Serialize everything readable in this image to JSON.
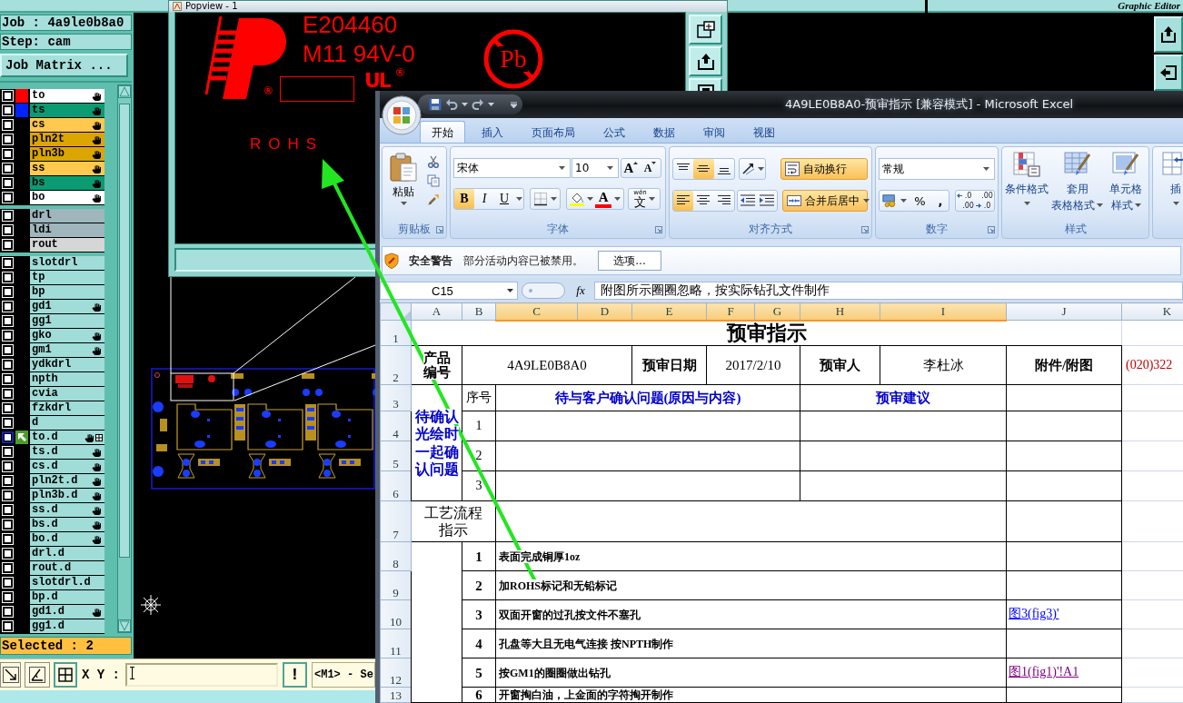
{
  "top_bar": {
    "title": "Graphic Editor"
  },
  "job_panel": {
    "job": "Job : 4a9le0b8a0",
    "step": "Step: cam",
    "matrix_button": "Job Matrix ..."
  },
  "layer_groups": [
    {
      "layers": [
        {
          "name": "to",
          "color": "#ffffff",
          "swatch": {
            "color": "#ff0000"
          },
          "hand": true,
          "checked": false,
          "active": false
        },
        {
          "name": "ts",
          "color": "#0b9a72",
          "swatch": {
            "color": "#0022ff"
          },
          "hand": true,
          "checked": false,
          "active": false
        },
        {
          "name": "cs",
          "color": "#ffc84e",
          "hand": true,
          "checked": false,
          "active": false
        },
        {
          "name": "pln2t",
          "color": "#dca600",
          "hand": true,
          "checked": false,
          "active": false
        },
        {
          "name": "pln3b",
          "color": "#dca600",
          "hand": true,
          "checked": false,
          "active": false
        },
        {
          "name": "ss",
          "color": "#ffc84e",
          "hand": true,
          "checked": false,
          "active": false
        },
        {
          "name": "bs",
          "color": "#0b9a72",
          "hand": true,
          "checked": false,
          "active": false
        },
        {
          "name": "bo",
          "color": "#ffffff",
          "hand": true,
          "checked": false,
          "active": false
        }
      ]
    },
    {
      "layers": [
        {
          "name": "drl",
          "color": "#9fb6bd",
          "hand": false,
          "checked": false,
          "active": false
        },
        {
          "name": "ldi",
          "color": "#9fb6bd",
          "hand": false,
          "checked": false,
          "active": false
        },
        {
          "name": "rout",
          "color": "#d6d6d6",
          "hand": false,
          "checked": false,
          "active": false
        }
      ]
    },
    {
      "layers": [
        {
          "name": "slotdrl",
          "color": "#a0dcd8",
          "hand": false,
          "checked": false,
          "active": false
        },
        {
          "name": "tp",
          "color": "#a0dcd8",
          "hand": false,
          "checked": false,
          "active": false
        },
        {
          "name": "bp",
          "color": "#a0dcd8",
          "hand": false,
          "checked": false,
          "active": false
        },
        {
          "name": "gd1",
          "color": "#a0dcd8",
          "hand": true,
          "checked": false,
          "active": false
        },
        {
          "name": "gg1",
          "color": "#a0dcd8",
          "hand": false,
          "checked": false,
          "active": false
        },
        {
          "name": "gko",
          "color": "#a0dcd8",
          "hand": true,
          "checked": false,
          "active": false
        },
        {
          "name": "gm1",
          "color": "#a0dcd8",
          "hand": true,
          "checked": false,
          "active": false
        },
        {
          "name": "ydkdrl",
          "color": "#a0dcd8",
          "hand": false,
          "checked": false,
          "active": false
        },
        {
          "name": "npth",
          "color": "#a0dcd8",
          "hand": false,
          "checked": false,
          "active": false
        },
        {
          "name": "cvia",
          "color": "#a0dcd8",
          "hand": false,
          "checked": false,
          "active": false
        },
        {
          "name": "fzkdrl",
          "color": "#a0dcd8",
          "hand": false,
          "checked": false,
          "active": false
        },
        {
          "name": "d",
          "color": "#a0dcd8",
          "hand": false,
          "checked": false,
          "active": false
        },
        {
          "name": "to.d",
          "color": "#a0dcd8",
          "hand": true,
          "checked": false,
          "active": true
        },
        {
          "name": "ts.d",
          "color": "#a0dcd8",
          "hand": true,
          "checked": false,
          "active": false
        },
        {
          "name": "cs.d",
          "color": "#a0dcd8",
          "hand": true,
          "checked": false,
          "active": false
        },
        {
          "name": "pln2t.d",
          "color": "#a0dcd8",
          "hand": true,
          "checked": false,
          "active": false
        },
        {
          "name": "pln3b.d",
          "color": "#a0dcd8",
          "hand": true,
          "checked": false,
          "active": false
        },
        {
          "name": "ss.d",
          "color": "#a0dcd8",
          "hand": true,
          "checked": false,
          "active": false
        },
        {
          "name": "bs.d",
          "color": "#a0dcd8",
          "hand": true,
          "checked": false,
          "active": false
        },
        {
          "name": "bo.d",
          "color": "#a0dcd8",
          "hand": true,
          "checked": false,
          "active": false
        },
        {
          "name": "drl.d",
          "color": "#a0dcd8",
          "hand": false,
          "checked": false,
          "active": false
        },
        {
          "name": "rout.d",
          "color": "#a0dcd8",
          "hand": false,
          "checked": false,
          "active": false
        },
        {
          "name": "slotdrl.d",
          "color": "#a0dcd8",
          "hand": false,
          "checked": false,
          "active": false
        },
        {
          "name": "bp.d",
          "color": "#a0dcd8",
          "hand": false,
          "checked": false,
          "active": false
        },
        {
          "name": "gd1.d",
          "color": "#a0dcd8",
          "hand": true,
          "checked": false,
          "active": false
        },
        {
          "name": "gg1.d",
          "color": "#a0dcd8",
          "hand": false,
          "checked": false,
          "active": false
        }
      ]
    }
  ],
  "selection": {
    "label": "Selected : 2"
  },
  "bottom_toolbar": {
    "coord_label": "X Y :",
    "alert_button": "!",
    "message": "<M1> - Se"
  },
  "popview": {
    "title": "Popview - 1",
    "code": "E204460",
    "rating": "M11 94V-0",
    "registered_marks": [
      "®",
      "®"
    ],
    "ul_mark": "UL",
    "lead_symbol": "Pb",
    "rohs": "ROHS"
  },
  "excel": {
    "title": "4A9LE0B8A0-预审指示 [兼容模式] - Microsoft Excel",
    "tabs": [
      {
        "label": "开始",
        "selected": true
      },
      {
        "label": "插入",
        "selected": false
      },
      {
        "label": "页面布局",
        "selected": false
      },
      {
        "label": "公式",
        "selected": false
      },
      {
        "label": "数据",
        "selected": false
      },
      {
        "label": "审阅",
        "selected": false
      },
      {
        "label": "视图",
        "selected": false
      }
    ],
    "clipboard": {
      "paste": "粘贴",
      "group": "剪贴板"
    },
    "font": {
      "name": "宋体",
      "size": "10",
      "grow": "A",
      "shrink": "A",
      "styles": [
        {
          "kind": "bold",
          "label": "B",
          "selected": true
        },
        {
          "kind": "italic",
          "label": "I",
          "selected": false
        },
        {
          "kind": "underline",
          "label": "U",
          "selected": false
        }
      ],
      "font_color": "A",
      "phonetic_top": "wén",
      "phonetic": "文",
      "group": "字体"
    },
    "alignment": {
      "vertical": [
        {
          "kind": "top",
          "selected": false
        },
        {
          "kind": "middle",
          "selected": true
        },
        {
          "kind": "bottom",
          "selected": false
        }
      ],
      "horizontal": [
        {
          "kind": "left",
          "selected": true
        },
        {
          "kind": "center",
          "selected": false
        },
        {
          "kind": "right",
          "selected": false
        }
      ],
      "wrap": {
        "label": "自动换行",
        "on": true
      },
      "merge": {
        "label": "合并后居中",
        "on": true
      },
      "group": "对齐方式"
    },
    "number": {
      "format": "常规",
      "percent": "%",
      "comma": ",",
      "decimals": [
        {
          "kind": "increase",
          "top": ".0",
          "bottom": ".00"
        },
        {
          "kind": "decrease",
          "top": ".00",
          "bottom": ".0"
        }
      ],
      "group": "数字"
    },
    "styles": {
      "buttons": [
        {
          "kind": "conditional",
          "lines": [
            "条件格式"
          ]
        },
        {
          "kind": "table",
          "lines": [
            "套用",
            "表格格式"
          ]
        },
        {
          "kind": "cell",
          "lines": [
            "单元格",
            "样式"
          ]
        }
      ],
      "group": "样式"
    },
    "insert": {
      "label": "插"
    },
    "security": {
      "title": "安全警告",
      "message": "部分活动内容已被禁用。",
      "button": "选项..."
    },
    "formula_bar": {
      "name_box": "C15",
      "function_button": "fx",
      "content": "附图所示圈圈忽略，按实际钻孔文件制作"
    },
    "sheet": {
      "columns": [
        {
          "label": "A",
          "selected": false
        },
        {
          "label": "B",
          "selected": false
        },
        {
          "label": "C",
          "selected": true
        },
        {
          "label": "D",
          "selected": true
        },
        {
          "label": "E",
          "selected": true
        },
        {
          "label": "F",
          "selected": true
        },
        {
          "label": "G",
          "selected": true
        },
        {
          "label": "H",
          "selected": true
        },
        {
          "label": "I",
          "selected": true
        },
        {
          "label": "J",
          "selected": false
        },
        {
          "label": "K",
          "selected": false
        }
      ],
      "rows": [
        {
          "number": "1",
          "kind": "title",
          "title": "预审指示"
        },
        {
          "number": "2",
          "kind": "info",
          "cells": [
            {
              "kind": "label",
              "text": "产品编号"
            },
            {
              "kind": "value",
              "text": "4A9LE0B8A0"
            },
            {
              "kind": "label",
              "text": "预审日期"
            },
            {
              "kind": "value",
              "text": "2017/2/10"
            },
            {
              "kind": "label",
              "text": "预审人"
            },
            {
              "kind": "value",
              "text": "李杜冰"
            },
            {
              "kind": "label",
              "text": "附件/附图"
            },
            {
              "kind": "note",
              "text": "(020)322"
            }
          ]
        },
        {
          "number": "3",
          "kind": "question_head",
          "group": "待确认光绘时一起确认问题",
          "index": "序号",
          "question": "待与客户确认问题(原因与内容)",
          "advice": "预审建议"
        },
        {
          "number": "4",
          "kind": "question",
          "index": "1"
        },
        {
          "number": "5",
          "kind": "question",
          "index": "2"
        },
        {
          "number": "6",
          "kind": "question",
          "index": "3"
        },
        {
          "number": "7",
          "kind": "process_head",
          "label": "工艺流程指示"
        },
        {
          "number": "8",
          "kind": "step",
          "index": "1",
          "text": "表面完成铜厚1oz"
        },
        {
          "number": "9",
          "kind": "step",
          "index": "2",
          "text": "加ROHS标记和无铅标记"
        },
        {
          "number": "10",
          "kind": "step",
          "index": "3",
          "text": "双面开窗的过孔按文件不塞孔",
          "link": {
            "text": "图3(fig3)'",
            "visited": false
          }
        },
        {
          "number": "11",
          "kind": "step",
          "index": "4",
          "text": "孔盘等大且无电气连接 按NPTH制作"
        },
        {
          "number": "12",
          "kind": "step",
          "index": "5",
          "text": "按GM1的圈圈做出钻孔",
          "link": {
            "text": "图1(fig1)'!A1",
            "visited": true
          }
        },
        {
          "number": "13",
          "kind": "step",
          "index": "6",
          "text": "开窗掏白油，上金面的字符掏开制作"
        }
      ]
    }
  }
}
